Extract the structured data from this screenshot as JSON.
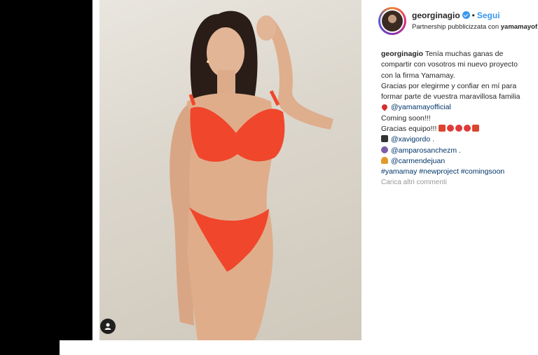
{
  "post": {
    "username": "georginagio",
    "follow_label": "Segui",
    "separator": "•",
    "partnership_prefix": "Partnership pubblicizzata con",
    "partner": "yamamayof..."
  },
  "caption": {
    "author": "georginagio",
    "lines": [
      "Tenía muchas ganas de",
      "compartir con vosotros mi nuevo proyecto",
      "con la firma Yamamay.",
      "Gracias por elegirme y confiar en mí para",
      "formar parte de vuestra maravillosa familia",
      "@yamamayofficial",
      "Coming soon!!!",
      "Gracias equipo!!!",
      "@xavigordo .",
      "@amparosanchezm .",
      "@carmendejuan",
      "#yamamay #newproject #comingsoon"
    ]
  },
  "load_more_comments": "Carica altri commenti",
  "icons": {
    "verified": "verified-badge-icon",
    "user_tag": "user-tag-icon",
    "heart": "red-heart-emoji",
    "clapper": "clapper-board-emoji",
    "woman": "woman-emoji",
    "bell": "bell-emoji"
  },
  "colors": {
    "link": "#3897f0",
    "bikini": "#f0462b",
    "text": "#262626",
    "muted": "#999999"
  }
}
